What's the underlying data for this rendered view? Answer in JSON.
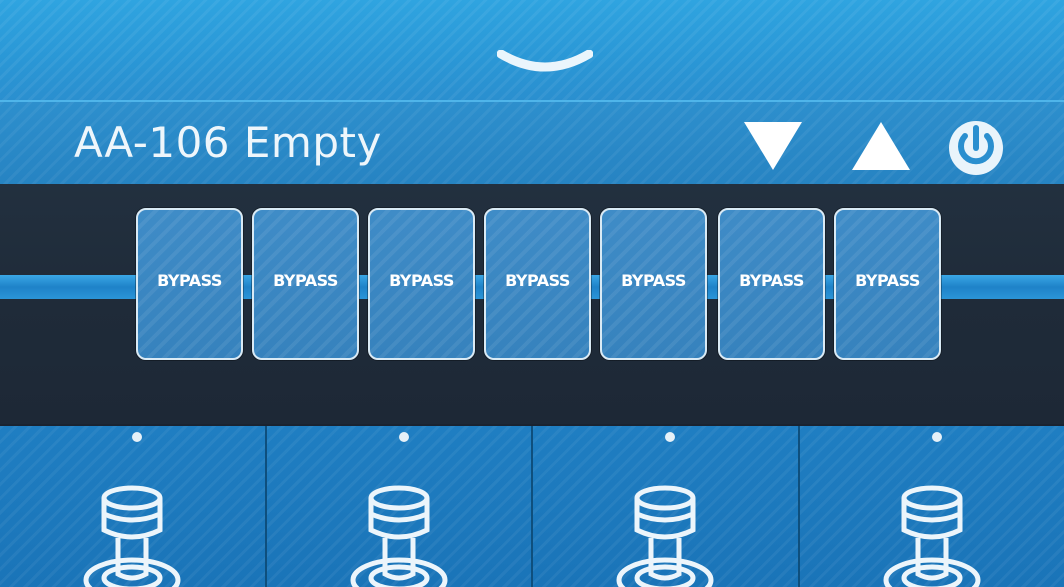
{
  "header": {
    "preset_name": "AA-106 Empty"
  },
  "controls": {
    "drawer_icon": "chevron-down-icon",
    "down_icon": "triangle-down-icon",
    "up_icon": "triangle-up-icon",
    "power_icon": "power-icon"
  },
  "effects_chain": {
    "slots": [
      {
        "label": "BYPASS"
      },
      {
        "label": "BYPASS"
      },
      {
        "label": "BYPASS"
      },
      {
        "label": "BYPASS"
      },
      {
        "label": "BYPASS"
      },
      {
        "label": "BYPASS"
      },
      {
        "label": "BYPASS"
      }
    ]
  },
  "footswitches": {
    "icon": "footswitch-icon",
    "count": 4
  },
  "colors": {
    "accent_blue": "#2a97d6",
    "panel_dark": "#1f2b39",
    "text_light": "#eef6fb"
  }
}
